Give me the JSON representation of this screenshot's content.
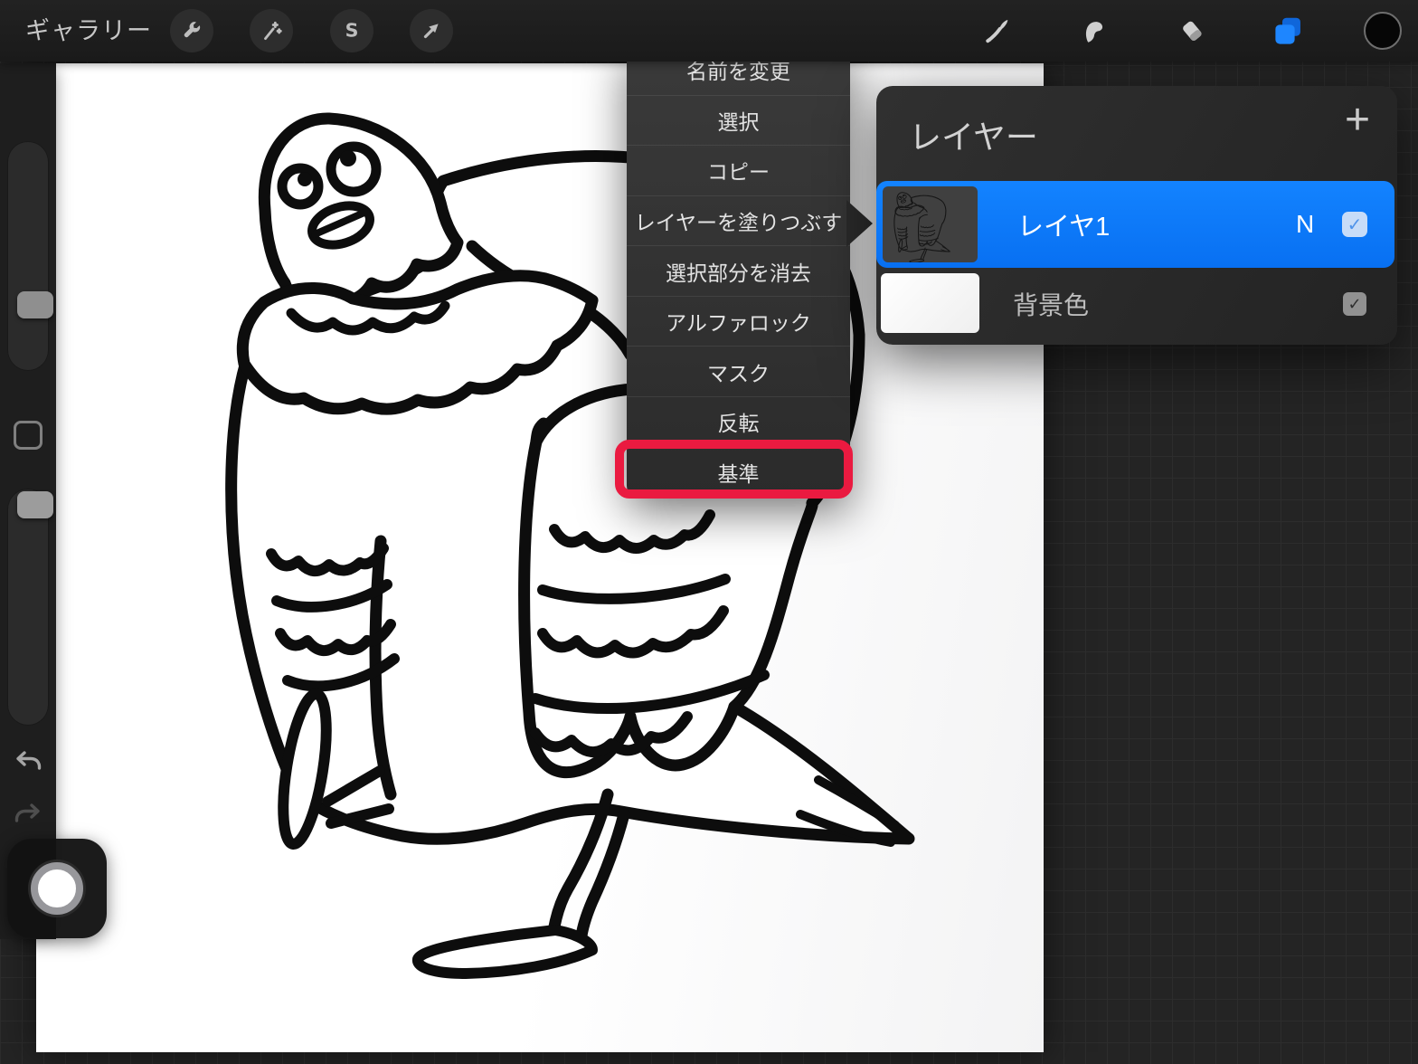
{
  "toolbar": {
    "gallery_label": "ギャラリー",
    "selection_icon_letter": "S"
  },
  "menu": {
    "items": [
      {
        "label": "名前を変更"
      },
      {
        "label": "選択"
      },
      {
        "label": "コピー"
      },
      {
        "label": "レイヤーを塗りつぶす"
      },
      {
        "label": "選択部分を消去"
      },
      {
        "label": "アルファロック"
      },
      {
        "label": "マスク"
      },
      {
        "label": "反転"
      },
      {
        "label": "基準"
      }
    ],
    "highlighted_item": "基準"
  },
  "layers_panel": {
    "title": "レイヤー",
    "add_label": "+",
    "layers": [
      {
        "name": "レイヤ1",
        "blend_mode": "N",
        "checked": true,
        "selected": true
      },
      {
        "name": "背景色",
        "checked": true,
        "selected": false
      }
    ]
  },
  "icons": {
    "check": "✓"
  },
  "colors": {
    "accent_blue": "#0d7bff",
    "highlight_red": "#ea1a40",
    "menu_bg": "#313131",
    "canvas_bg": "#ffffff"
  }
}
